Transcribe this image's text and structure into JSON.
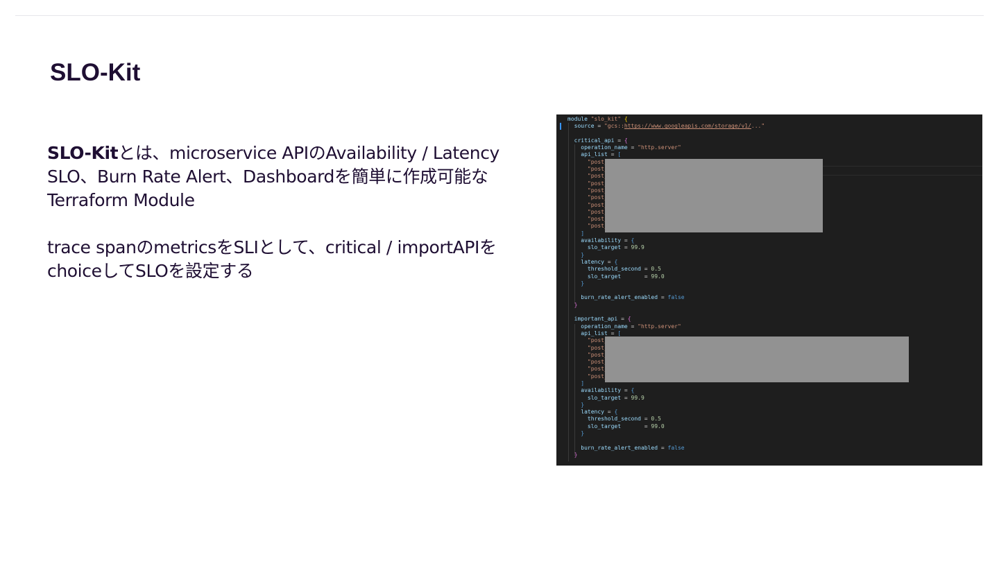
{
  "title": "SLO-Kit",
  "paragraphs": [
    {
      "strong": "SLO-Kit",
      "text": "とは、microservice APIのAvailability / Latency SLO、Burn Rate Alert、Dashboardを簡単に作成可能なTerraform Module"
    },
    {
      "text": "trace spanのmetricsをSLIとして、critical / importAPIをchoiceしてSLOを設定する"
    }
  ],
  "code": {
    "lines": [
      [
        {
          "t": "id",
          "v": "module "
        },
        {
          "t": "str",
          "v": "\"slo_kit\""
        },
        {
          "t": "op",
          "v": " "
        },
        {
          "t": "br",
          "v": "{"
        }
      ],
      [
        {
          "t": "id",
          "v": "  source"
        },
        {
          "t": "op",
          "v": " = "
        },
        {
          "t": "str",
          "v": "\"gcs::"
        },
        {
          "t": "url",
          "v": "https://www.googleapis.com/storage/v1/"
        },
        {
          "t": "str",
          "v": "...\""
        }
      ],
      [],
      [
        {
          "t": "id",
          "v": "  critical_api"
        },
        {
          "t": "op",
          "v": " = "
        },
        {
          "t": "br2",
          "v": "{"
        }
      ],
      [
        {
          "t": "id",
          "v": "    operation_name"
        },
        {
          "t": "op",
          "v": " = "
        },
        {
          "t": "str",
          "v": "\"http.server\""
        }
      ],
      [
        {
          "t": "id",
          "v": "    api_list"
        },
        {
          "t": "op",
          "v": " = "
        },
        {
          "t": "kw",
          "v": "["
        }
      ],
      [
        {
          "t": "str",
          "v": "      \"post_/"
        }
      ],
      [
        {
          "t": "str",
          "v": "      \"post_/"
        }
      ],
      [
        {
          "t": "str",
          "v": "      \"post_/"
        }
      ],
      [
        {
          "t": "str",
          "v": "      \"post_/"
        }
      ],
      [
        {
          "t": "str",
          "v": "      \"post_/"
        }
      ],
      [
        {
          "t": "str",
          "v": "      \"post_/"
        }
      ],
      [
        {
          "t": "str",
          "v": "      \"post_/"
        }
      ],
      [
        {
          "t": "str",
          "v": "      \"post_/"
        }
      ],
      [
        {
          "t": "str",
          "v": "      \"post_/"
        }
      ],
      [
        {
          "t": "str",
          "v": "      \"post_/"
        }
      ],
      [
        {
          "t": "kw",
          "v": "    ]"
        }
      ],
      [
        {
          "t": "id",
          "v": "    availability"
        },
        {
          "t": "op",
          "v": " = "
        },
        {
          "t": "kw",
          "v": "{"
        }
      ],
      [
        {
          "t": "id",
          "v": "      slo_target"
        },
        {
          "t": "op",
          "v": " = "
        },
        {
          "t": "num",
          "v": "99.9"
        }
      ],
      [
        {
          "t": "kw",
          "v": "    }"
        }
      ],
      [
        {
          "t": "id",
          "v": "    latency"
        },
        {
          "t": "op",
          "v": " = "
        },
        {
          "t": "kw",
          "v": "{"
        }
      ],
      [
        {
          "t": "id",
          "v": "      threshold_second"
        },
        {
          "t": "op",
          "v": " = "
        },
        {
          "t": "num",
          "v": "0.5"
        }
      ],
      [
        {
          "t": "id",
          "v": "      slo_target"
        },
        {
          "t": "op",
          "v": "       = "
        },
        {
          "t": "num",
          "v": "99.0"
        }
      ],
      [
        {
          "t": "kw",
          "v": "    }"
        }
      ],
      [],
      [
        {
          "t": "id",
          "v": "    burn_rate_alert_enabled"
        },
        {
          "t": "op",
          "v": " = "
        },
        {
          "t": "kw",
          "v": "false"
        }
      ],
      [
        {
          "t": "br2",
          "v": "  }"
        }
      ],
      [],
      [
        {
          "t": "id",
          "v": "  important_api"
        },
        {
          "t": "op",
          "v": " = "
        },
        {
          "t": "br2",
          "v": "{"
        }
      ],
      [
        {
          "t": "id",
          "v": "    operation_name"
        },
        {
          "t": "op",
          "v": " = "
        },
        {
          "t": "str",
          "v": "\"http.server\""
        }
      ],
      [
        {
          "t": "id",
          "v": "    api_list"
        },
        {
          "t": "op",
          "v": " = "
        },
        {
          "t": "kw",
          "v": "["
        }
      ],
      [
        {
          "t": "str",
          "v": "      \"post_/"
        }
      ],
      [
        {
          "t": "str",
          "v": "      \"post_/"
        }
      ],
      [
        {
          "t": "str",
          "v": "      \"post_/"
        }
      ],
      [
        {
          "t": "str",
          "v": "      \"post_/"
        }
      ],
      [
        {
          "t": "str",
          "v": "      \"post_/"
        }
      ],
      [
        {
          "t": "str",
          "v": "      \"post_/"
        }
      ],
      [
        {
          "t": "kw",
          "v": "    ]"
        }
      ],
      [
        {
          "t": "id",
          "v": "    availability"
        },
        {
          "t": "op",
          "v": " = "
        },
        {
          "t": "kw",
          "v": "{"
        }
      ],
      [
        {
          "t": "id",
          "v": "      slo_target"
        },
        {
          "t": "op",
          "v": " = "
        },
        {
          "t": "num",
          "v": "99.9"
        }
      ],
      [
        {
          "t": "kw",
          "v": "    }"
        }
      ],
      [
        {
          "t": "id",
          "v": "    latency"
        },
        {
          "t": "op",
          "v": " = "
        },
        {
          "t": "kw",
          "v": "{"
        }
      ],
      [
        {
          "t": "id",
          "v": "      threshold_second"
        },
        {
          "t": "op",
          "v": " = "
        },
        {
          "t": "num",
          "v": "0.5"
        }
      ],
      [
        {
          "t": "id",
          "v": "      slo_target"
        },
        {
          "t": "op",
          "v": "       = "
        },
        {
          "t": "num",
          "v": "99.0"
        }
      ],
      [
        {
          "t": "kw",
          "v": "    }"
        }
      ],
      [],
      [
        {
          "t": "id",
          "v": "    burn_rate_alert_enabled"
        },
        {
          "t": "op",
          "v": " = "
        },
        {
          "t": "kw",
          "v": "false"
        }
      ],
      [
        {
          "t": "br2",
          "v": "  }"
        }
      ]
    ]
  },
  "colors": {
    "title": "#1f0f33",
    "code_bg": "#1e1e1e",
    "redaction": "#929292"
  }
}
